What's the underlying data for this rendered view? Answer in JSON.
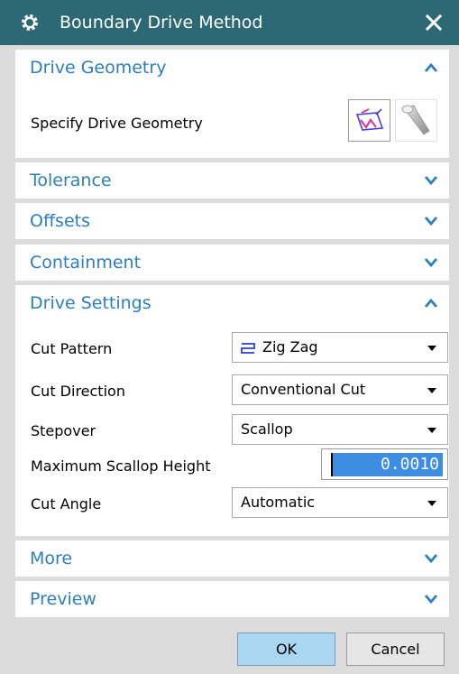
{
  "window": {
    "title": "Boundary Drive Method",
    "icon": "gear-icon",
    "close_icon": "close-icon"
  },
  "sections": {
    "drive_geometry": {
      "label": "Drive Geometry",
      "state": "expanded",
      "chevron": "chevron-up-icon"
    },
    "tolerance": {
      "label": "Tolerance",
      "state": "collapsed",
      "chevron": "chevron-down-icon"
    },
    "offsets": {
      "label": "Offsets",
      "state": "collapsed",
      "chevron": "chevron-down-icon"
    },
    "containment": {
      "label": "Containment",
      "state": "collapsed",
      "chevron": "chevron-down-icon"
    },
    "drive_settings": {
      "label": "Drive Settings",
      "state": "expanded",
      "chevron": "chevron-up-icon"
    },
    "more": {
      "label": "More",
      "state": "collapsed",
      "chevron": "chevron-down-icon"
    },
    "preview": {
      "label": "Preview",
      "state": "collapsed",
      "chevron": "chevron-down-icon"
    }
  },
  "drive_geometry": {
    "specify_label": "Specify Drive Geometry",
    "select_icon": "boundary-geometry-icon",
    "display_icon": "flashlight-icon"
  },
  "drive_settings": {
    "cut_pattern": {
      "label": "Cut Pattern",
      "value": "Zig Zag",
      "icon": "zig-zag-icon"
    },
    "cut_direction": {
      "label": "Cut Direction",
      "value": "Conventional Cut"
    },
    "stepover": {
      "label": "Stepover",
      "value": "Scallop"
    },
    "max_scallop_height": {
      "label": "Maximum Scallop Height",
      "value": "0.0010"
    },
    "cut_angle": {
      "label": "Cut Angle",
      "value": "Automatic"
    }
  },
  "buttons": {
    "ok": "OK",
    "cancel": "Cancel"
  },
  "colors": {
    "titlebar": "#2c6974",
    "section_label": "#2b7fba",
    "ok_button": "#a9d7f2",
    "selection": "#3d8ee2",
    "dialog_bg": "#dcdcdc"
  }
}
